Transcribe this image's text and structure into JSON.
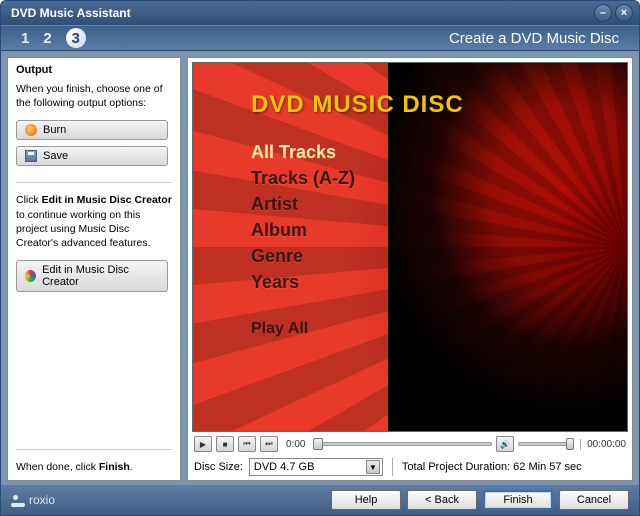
{
  "window": {
    "title": "DVD Music Assistant"
  },
  "stepbar": {
    "steps": [
      "1",
      "2",
      "3"
    ],
    "current_index": 2,
    "title": "Create a DVD Music Disc"
  },
  "sidebar": {
    "section_title": "Output",
    "instruction": "When you finish, choose one of the following output options:",
    "burn_label": "Burn",
    "save_label": "Save",
    "creator_note_prefix": "Click ",
    "creator_note_bold": "Edit in Music Disc Creator",
    "creator_note_suffix": " to continue working on this project using Music Disc Creator's advanced features.",
    "edit_label": "Edit in Music Disc Creator",
    "finish_note_prefix": "When done, click ",
    "finish_note_bold": "Finish",
    "finish_note_suffix": "."
  },
  "preview": {
    "title": "DVD MUSIC DISC",
    "items": [
      "All Tracks",
      "Tracks (A-Z)",
      "Artist",
      "Album",
      "Genre",
      "Years"
    ],
    "play_all": "Play All"
  },
  "transport": {
    "current_time": "0:00",
    "total_time": "00:00:00"
  },
  "disc": {
    "label": "Disc Size:",
    "selected": "DVD 4.7 GB",
    "duration_label": "Total Project Duration: 62 Min 57 sec"
  },
  "footer": {
    "brand": "roxio",
    "help": "Help",
    "back": "< Back",
    "finish": "Finish",
    "cancel": "Cancel"
  }
}
